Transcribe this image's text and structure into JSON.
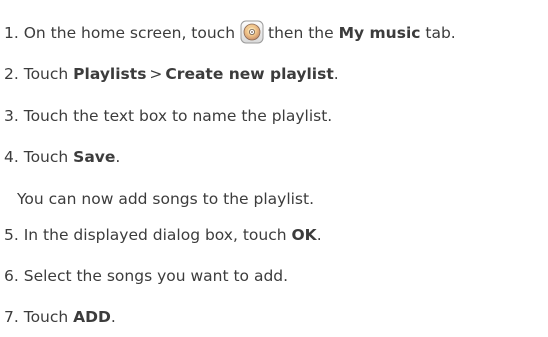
{
  "steps": {
    "s1": {
      "num": "1.",
      "text_a": "On the home screen, touch",
      "text_b": "then the",
      "bold": "My music",
      "text_c": "tab.",
      "icon": "music-player-disc-icon"
    },
    "s2": {
      "num": "2.",
      "text_a": "Touch",
      "bold_a": "Playlists",
      "sep": ">",
      "bold_b": "Create new playlist",
      "end": "."
    },
    "s3": {
      "num": "3.",
      "text": "Touch the text box to name the playlist."
    },
    "s4": {
      "num": "4.",
      "text": "Touch",
      "bold": "Save",
      "end": "."
    },
    "s4_note": "You can now add songs to the playlist.",
    "s5": {
      "num": "5.",
      "text": "In the displayed dialog box, touch",
      "bold": "OK",
      "end": "."
    },
    "s6": {
      "num": "6.",
      "text": "Select the songs you want to add."
    },
    "s7": {
      "num": "7.",
      "text": "Touch",
      "bold": "ADD",
      "end": "."
    }
  }
}
